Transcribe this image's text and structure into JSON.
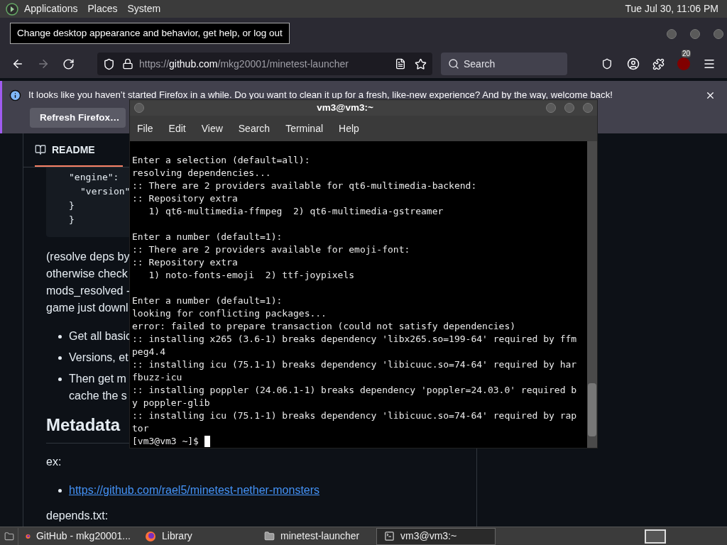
{
  "top_panel": {
    "menus": [
      "Applications",
      "Places",
      "System"
    ],
    "clock": "Tue Jul 30, 11:06 PM"
  },
  "tooltip": "Change desktop appearance and behavior, get help, or log out",
  "browser": {
    "url": {
      "scheme": "https://",
      "domain": "github.com",
      "path": "/mkg20001/minetest-launcher"
    },
    "search_placeholder": "Search",
    "extension_badge": "20",
    "notification": {
      "message": "It looks like you haven’t started Firefox in a while. Do you want to clean it up for a fresh, like-new experience? And by the way, welcome back!",
      "button": "Refresh Firefox…"
    },
    "readme": {
      "tab": {
        "label": "README",
        "selected": true
      },
      "code_lines": [
        {
          "text": "\"engine\":",
          "indent": false
        },
        {
          "text": "\"version\"",
          "indent": true
        },
        {
          "text": "}",
          "indent": false
        },
        {
          "text": "}",
          "indent": false
        }
      ],
      "paragraph_lines": [
        "(resolve deps by",
        "otherwise check",
        "mods_resolved -",
        "game just downl"
      ],
      "bullets": [
        {
          "lines": [
            "Get all basic"
          ]
        },
        {
          "lines": [
            "Versions, et"
          ]
        },
        {
          "lines": [
            "Then get m",
            "cache the s"
          ]
        }
      ],
      "heading": "Metadata",
      "example_label": "ex:",
      "link": "https://github.com/rael5/minetest-nether-monsters",
      "trailing_label": "depends.txt:"
    }
  },
  "terminal": {
    "title": "vm3@vm3:~",
    "menus": [
      "File",
      "Edit",
      "View",
      "Search",
      "Terminal",
      "Help"
    ],
    "output": [
      {
        "lines": [
          "Enter a selection (default=all):",
          "resolving dependencies...",
          ":: There are 2 providers available for qt6-multimedia-backend:",
          ":: Repository extra",
          "   1) qt6-multimedia-ffmpeg  2) qt6-multimedia-gstreamer"
        ]
      },
      {
        "lines": [
          "Enter a number (default=1):",
          ":: There are 2 providers available for emoji-font:",
          ":: Repository extra",
          "   1) noto-fonts-emoji  2) ttf-joypixels"
        ]
      },
      {
        "lines": [
          "Enter a number (default=1):",
          "looking for conflicting packages...",
          "error: failed to prepare transaction (could not satisfy dependencies)",
          ":: installing x265 (3.6-1) breaks dependency 'libx265.so=199-64' required by ffm",
          "peg4.4",
          ":: installing icu (75.1-1) breaks dependency 'libicuuc.so=74-64' required by har",
          "fbuzz-icu",
          ":: installing poppler (24.06.1-1) breaks dependency 'poppler=24.03.0' required b",
          "y poppler-glib",
          ":: installing icu (75.1-1) breaks dependency 'libicuuc.so=74-64' required by rap",
          "tor"
        ]
      }
    ],
    "prompt": "[vm3@vm3 ~]$"
  },
  "taskbar": {
    "items": [
      {
        "kind": "firefox",
        "label": "GitHub - mkg20001...",
        "selected": false
      },
      {
        "kind": "firefox",
        "label": "Library",
        "selected": false
      },
      {
        "kind": "folder",
        "label": "minetest-launcher",
        "selected": false
      },
      {
        "kind": "terminal",
        "label": "vm3@vm3:~",
        "selected": true
      }
    ]
  }
}
